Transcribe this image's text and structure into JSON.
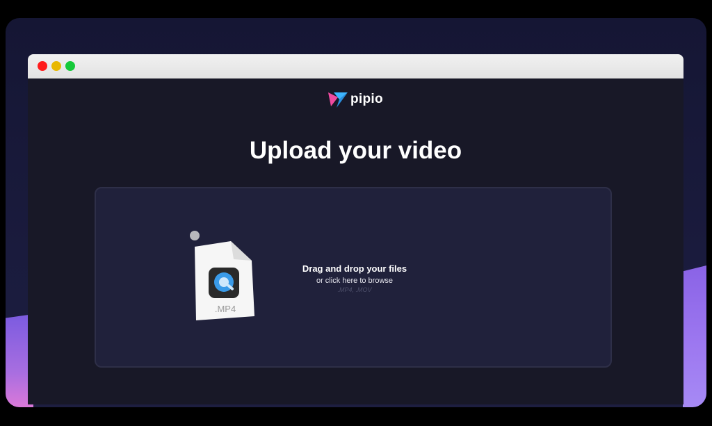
{
  "brand": {
    "name": "pipio",
    "colors": {
      "logo_pink": "#f04aa0",
      "logo_blue": "#3db5ff",
      "accent_purple": "#9d78f0"
    }
  },
  "window": {
    "controls": [
      "close",
      "minimize",
      "zoom"
    ]
  },
  "upload": {
    "heading": "Upload your video",
    "dropzone": {
      "title": "Drag and drop your files",
      "subtitle": "or click here to browse",
      "formats": ".MP4, .MOV"
    },
    "file_icon": {
      "label": ".MP4",
      "icon": "quicktime-icon"
    }
  }
}
